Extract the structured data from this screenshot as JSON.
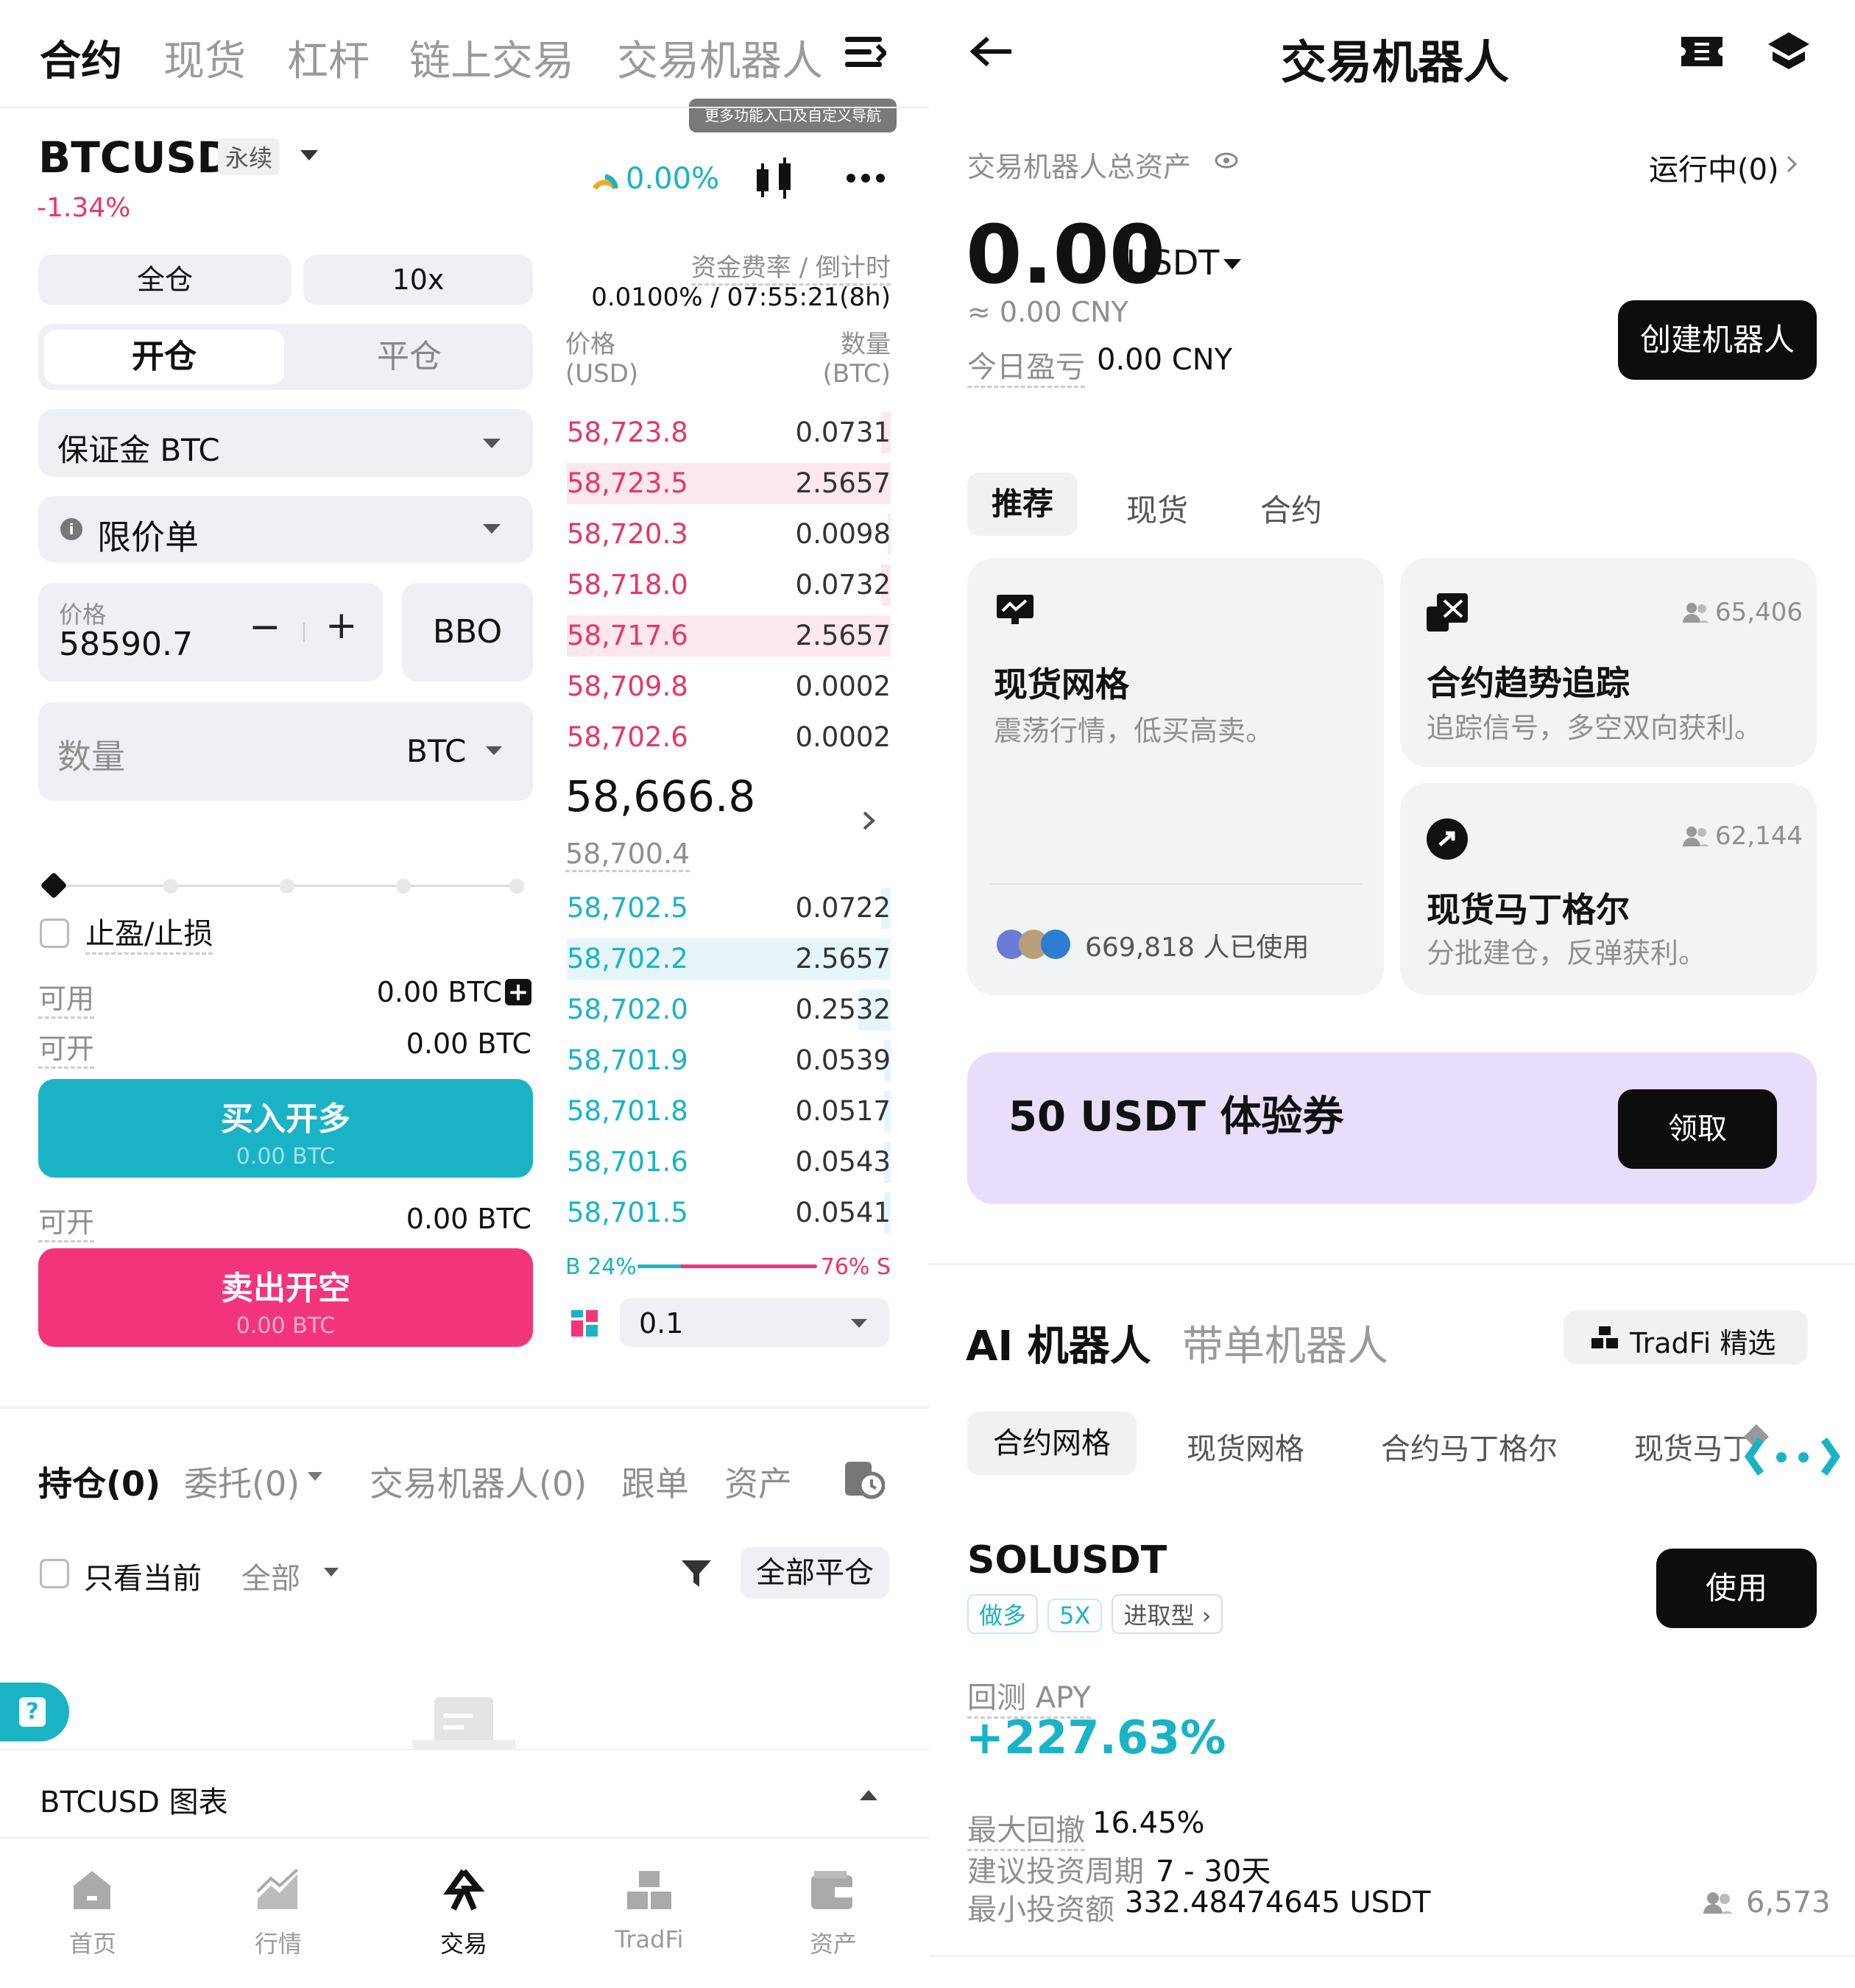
{
  "left": {
    "top_tabs": [
      "合约",
      "现货",
      "杠杆",
      "链上交易",
      "交易机器人"
    ],
    "tooltip": "更多功能入口及自定义导航",
    "symbol": "BTCUSD",
    "symbol_tag": "永续",
    "change": "-1.34%",
    "funding_gauge": "0.00%",
    "margin_mode": "全仓",
    "leverage": "10x",
    "open_tab": "开仓",
    "close_tab": "平仓",
    "margin_select": "保证金 BTC",
    "order_type": "限价单",
    "price_label": "价格",
    "price_value": "58590.7",
    "bbo": "BBO",
    "qty_placeholder": "数量",
    "qty_unit": "BTC",
    "tpsl": "止盈/止损",
    "avail_label": "可用",
    "avail_value": "0.00 BTC",
    "openable_label": "可开",
    "openable_value": "0.00 BTC",
    "buy_label": "买入开多",
    "buy_sub": "0.00 BTC",
    "openable2_label": "可开",
    "openable2_value": "0.00 BTC",
    "sell_label": "卖出开空",
    "sell_sub": "0.00 BTC",
    "funding_label": "资金费率 / 倒计时",
    "funding_value": "0.0100% / 07:55:21(8h)",
    "price_col": "价格",
    "price_unit": "(USD)",
    "qty_col": "数量",
    "qty_col_unit": "(BTC)",
    "asks": [
      {
        "p": "58,723.8",
        "q": "0.0731",
        "depth": 0.03
      },
      {
        "p": "58,723.5",
        "q": "2.5657",
        "depth": 1.0
      },
      {
        "p": "58,720.3",
        "q": "0.0098",
        "depth": 0.01
      },
      {
        "p": "58,718.0",
        "q": "0.0732",
        "depth": 0.03
      },
      {
        "p": "58,717.6",
        "q": "2.5657",
        "depth": 1.0
      },
      {
        "p": "58,709.8",
        "q": "0.0002",
        "depth": 0.0
      },
      {
        "p": "58,702.6",
        "q": "0.0002",
        "depth": 0.0
      }
    ],
    "last_price": "58,666.8",
    "mark_price": "58,700.4",
    "bids": [
      {
        "p": "58,702.5",
        "q": "0.0722",
        "depth": 0.03
      },
      {
        "p": "58,702.2",
        "q": "2.5657",
        "depth": 1.0
      },
      {
        "p": "58,702.0",
        "q": "0.2532",
        "depth": 0.1
      },
      {
        "p": "58,701.9",
        "q": "0.0539",
        "depth": 0.02
      },
      {
        "p": "58,701.8",
        "q": "0.0517",
        "depth": 0.02
      },
      {
        "p": "58,701.6",
        "q": "0.0543",
        "depth": 0.02
      },
      {
        "p": "58,701.5",
        "q": "0.0541",
        "depth": 0.02
      }
    ],
    "ratio_b": "B 24%",
    "ratio_s": "76% S",
    "ratio_b_value": 0.24,
    "precision": "0.1",
    "bottom_tabs": [
      "持仓(0)",
      "委托(0)",
      "交易机器人(0)",
      "跟单",
      "资产"
    ],
    "only_current": "只看当前",
    "all_filter": "全部",
    "close_all": "全部平仓",
    "chart_bar": "BTCUSD 图表",
    "nav": [
      "首页",
      "行情",
      "交易",
      "TradFi",
      "资产"
    ],
    "colors": {
      "buy": "#19b3c5",
      "sell": "#f2357a"
    }
  },
  "right": {
    "title": "交易机器人",
    "total_label": "交易机器人总资产",
    "running": "运行中(0)",
    "total_value": "0.00",
    "total_unit": "USDT",
    "cny": "≈ 0.00 CNY",
    "pnl_label": "今日盈亏",
    "pnl_value": "0.00 CNY",
    "create_btn": "创建机器人",
    "cat_tabs": [
      "推荐",
      "现货",
      "合约"
    ],
    "cards": [
      {
        "title": "现货网格",
        "desc": "震荡行情，低买高卖。",
        "users": "669,818 人已使用"
      },
      {
        "title": "合约趋势追踪",
        "desc": "追踪信号，多空双向获利。",
        "count": "65,406"
      },
      {
        "title": "现货马丁格尔",
        "desc": "分批建仓，反弹获利。",
        "count": "62,144"
      }
    ],
    "promo": "50 USDT 体验券",
    "claim": "领取",
    "ai_tab": "AI 机器人",
    "copy_tab": "带单机器人",
    "tradfi": "TradFi 精选",
    "sub_tabs": [
      "合约网格",
      "现货网格",
      "合约马丁格尔",
      "现货马丁"
    ],
    "strategy": {
      "symbol": "SOLUSDT",
      "tags": [
        "做多",
        "5X",
        "进取型"
      ],
      "use": "使用",
      "apy_label": "回测 APY",
      "apy": "+227.63%",
      "drawdown_label": "最大回撤",
      "drawdown": "16.45%",
      "period_label": "建议投资周期",
      "period": "7 - 30天",
      "min_label": "最小投资额",
      "min": "332.48474645 USDT",
      "users": "6,573"
    }
  }
}
